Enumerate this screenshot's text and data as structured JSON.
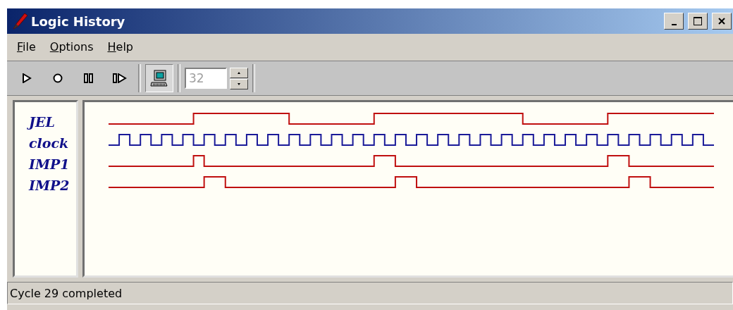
{
  "window": {
    "title": "Logic History"
  },
  "menu": [
    {
      "label": "File"
    },
    {
      "label": "Options"
    },
    {
      "label": "Help"
    }
  ],
  "toolbar": {
    "buttons": [
      {
        "kind": "play",
        "pressed": false
      },
      {
        "kind": "record",
        "pressed": false
      },
      {
        "kind": "pause",
        "pressed": false
      },
      {
        "kind": "step",
        "pressed": false
      },
      {
        "kind": "computer",
        "pressed": true
      }
    ],
    "cycles_field": {
      "value": "32",
      "disabled": true
    }
  },
  "signals": [
    {
      "name": "JEL",
      "color": "#c01010"
    },
    {
      "name": "clock",
      "color": "#1a1a99"
    },
    {
      "name": "IMP1",
      "color": "#c01010"
    },
    {
      "name": "IMP2",
      "color": "#c01010"
    }
  ],
  "status_bar": "Cycle 29 completed"
}
